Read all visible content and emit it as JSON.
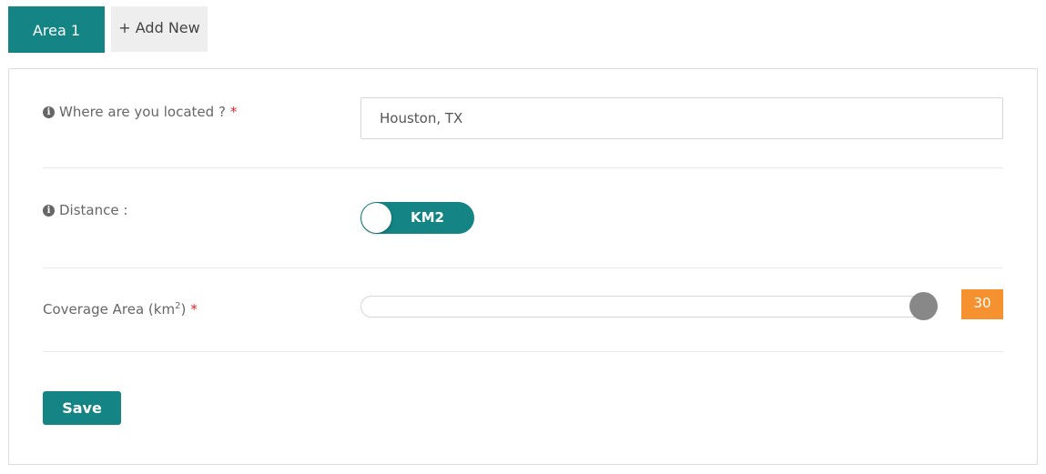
{
  "tabs": [
    {
      "label": "Area 1",
      "active": true
    },
    {
      "label": "+ Add New",
      "active": false
    }
  ],
  "form": {
    "location": {
      "label": "Where are you located ?",
      "required_mark": "*",
      "value": "Houston, TX"
    },
    "distance": {
      "label": "Distance :",
      "toggle_label": "KM2"
    },
    "coverage": {
      "label": "Coverage Area (km",
      "superscript": "2",
      "label_suffix": ")",
      "required_mark": "*",
      "value": "30",
      "slider_fraction": 0.98
    },
    "save_label": "Save"
  },
  "colors": {
    "primary": "#148485",
    "badge": "#f5922f",
    "required": "#e0252a"
  },
  "icons": {
    "info": "info-circle-icon"
  }
}
